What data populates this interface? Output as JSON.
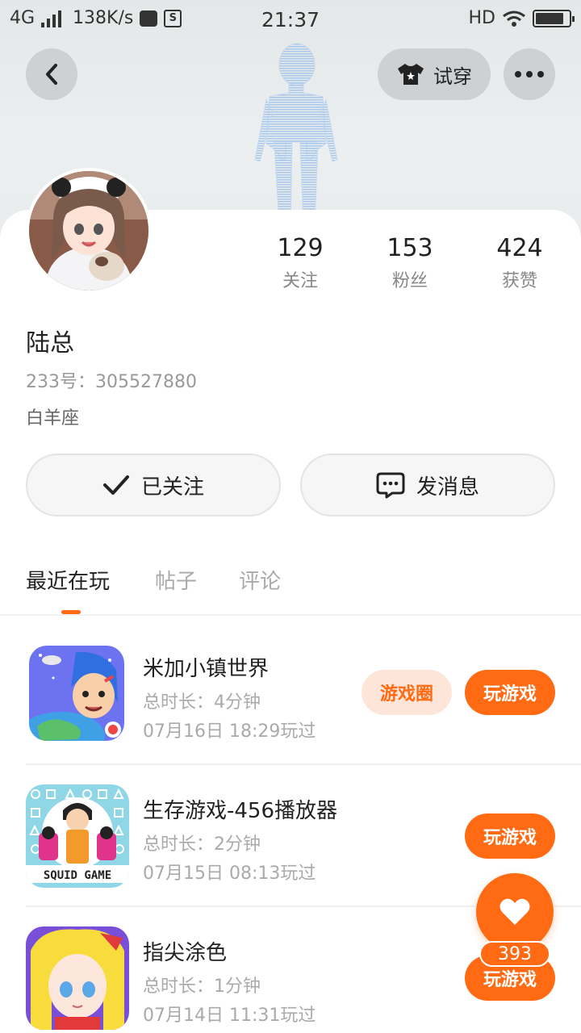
{
  "status_bar": {
    "network": "4G",
    "speed": "138K/s",
    "time": "21:37",
    "hd": "HD"
  },
  "header": {
    "try_on_label": "试穿"
  },
  "profile": {
    "stats": [
      {
        "num": "129",
        "label": "关注"
      },
      {
        "num": "153",
        "label": "粉丝"
      },
      {
        "num": "424",
        "label": "获赞"
      }
    ],
    "nickname": "陆总",
    "uid": "233号：305527880",
    "zodiac": "白羊座"
  },
  "actions": {
    "followed_label": "已关注",
    "message_label": "发消息"
  },
  "tabs": [
    "最近在玩",
    "帖子",
    "评论"
  ],
  "games": [
    {
      "title": "米加小镇世界",
      "duration": "总时长：4分钟",
      "last_played": "07月16日 18:29玩过",
      "circle_label": "游戏圈",
      "play_label": "玩游戏"
    },
    {
      "title": "生存游戏-456播放器",
      "duration": "总时长：2分钟",
      "last_played": "07月15日 08:13玩过",
      "icon_text": "SQUID GAME",
      "play_label": "玩游戏"
    },
    {
      "title": "指尖涂色",
      "duration": "总时长：1分钟",
      "last_played": "07月14日 11:31玩过",
      "play_label": "玩游戏"
    }
  ],
  "like": {
    "count": "393"
  },
  "colors": {
    "accent": "#ff6a13",
    "accent_light": "#fde6d9"
  }
}
